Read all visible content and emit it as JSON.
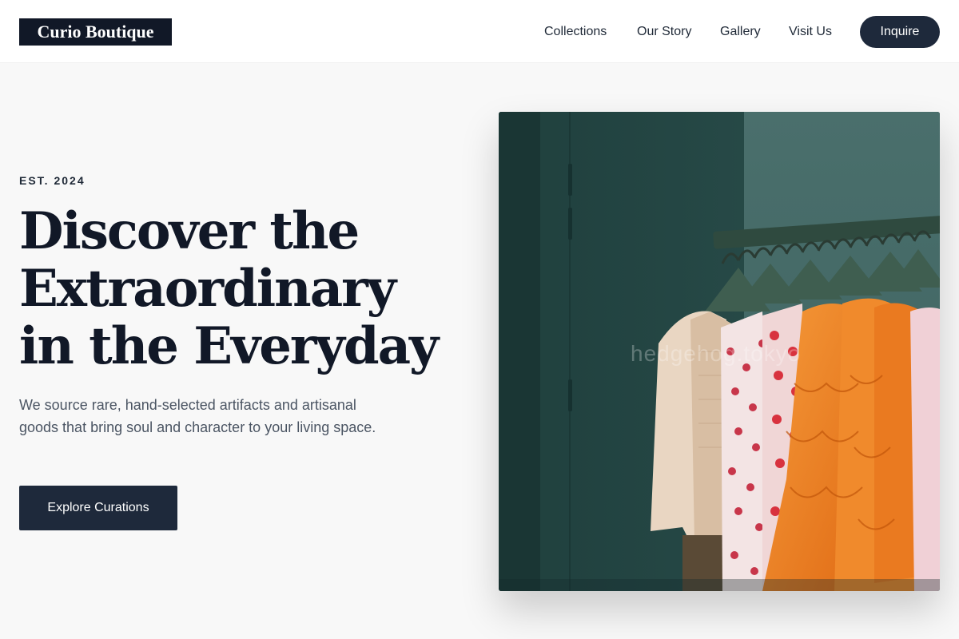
{
  "header": {
    "logo": "Curio Boutique",
    "nav": [
      {
        "label": "Collections"
      },
      {
        "label": "Our Story"
      },
      {
        "label": "Gallery"
      },
      {
        "label": "Visit Us"
      }
    ],
    "cta_label": "Inquire"
  },
  "hero": {
    "eyebrow": "EST. 2024",
    "headline_lines": [
      "Discover the",
      "Extraordinary",
      "in the Everyday"
    ],
    "subtext": "We source rare, hand-selected artifacts and artisanal goods that bring soul and character to your living space.",
    "cta_label": "Explore Curations",
    "image": {
      "subject": "clothing-rack-photo",
      "watermark": "hedgehog.tokyo"
    }
  },
  "colors": {
    "page_background": "#f8f8f8",
    "header_background": "#ffffff",
    "primary_dark": "#1e293b",
    "text_dark": "#111827",
    "text_muted": "#4b5563"
  }
}
